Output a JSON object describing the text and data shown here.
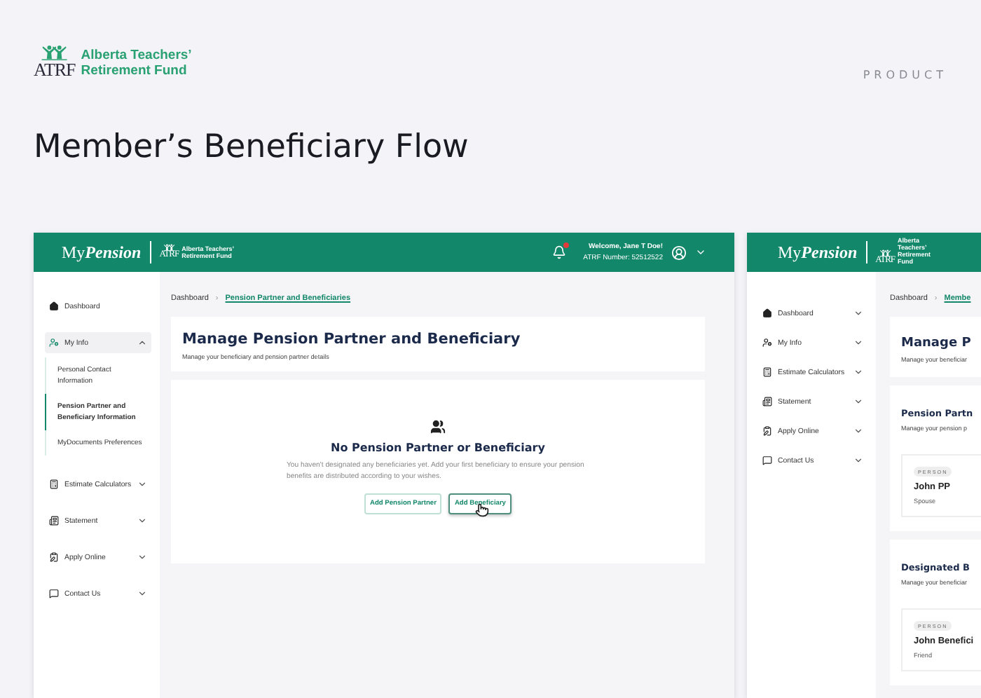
{
  "brand": {
    "mark": "ATRF",
    "line1": "Alberta Teachers’",
    "line2": "Retirement Fund"
  },
  "category": "PRODUCT",
  "title": "Member’s Beneficiary Flow",
  "screens": [
    {
      "kind": "empty",
      "app_name": {
        "prefix": "My",
        "accent": "Pension"
      },
      "org": {
        "mark": "ATRF",
        "line1": "Alberta Teachers’",
        "line2": "Retirement Fund"
      },
      "user": {
        "welcome": "Welcome, Jane T Doe!",
        "number": "ATRF Number: 52512522"
      },
      "sidebar": [
        {
          "label": "Dashboard",
          "selected": false
        },
        {
          "label": "My Info",
          "selected": true,
          "expanded": true,
          "children": [
            {
              "label": "Personal Contact Information",
              "selected": false
            },
            {
              "label": "Pension Partner and Beneficiary Information",
              "selected": true
            },
            {
              "label": "MyDocuments Preferences",
              "selected": false
            }
          ]
        },
        {
          "label": "Estimate Calculators",
          "selected": false,
          "expanded": false
        },
        {
          "label": "Statement",
          "selected": false,
          "expanded": false
        },
        {
          "label": "Apply Online",
          "selected": false,
          "expanded": false
        },
        {
          "label": "Contact Us",
          "selected": false,
          "expanded": false
        }
      ],
      "breadcrumb": {
        "items": [
          "Dashboard",
          "Pension Partner and Beneficiaries"
        ],
        "separator": "›"
      },
      "page_title": "Manage Pension Partner and Beneficiary",
      "page_subtitle": "Manage your beneficiary and pension partner details",
      "empty": {
        "title": "No Pension Partner or Beneficiary",
        "text": "You haven't designated any beneficiaries yet. Add your first beneficiary to ensure your pension benefits are distributed according to your wishes.",
        "buttons": [
          {
            "label": "Add Pension Partner",
            "hovered": false
          },
          {
            "label": "Add Beneficiary",
            "hovered": true
          }
        ]
      }
    },
    {
      "kind": "list",
      "app_name": {
        "prefix": "My",
        "accent": "Pension"
      },
      "org": {
        "mark": "ATRF",
        "line1": "Alberta Teachers’",
        "line2": "Retirement Fund"
      },
      "sidebar": [
        {
          "label": "Dashboard",
          "selected": false,
          "expanded": false
        },
        {
          "label": "My Info",
          "selected": false,
          "expanded": false
        },
        {
          "label": "Estimate Calculators",
          "selected": false,
          "expanded": false
        },
        {
          "label": "Statement",
          "selected": false,
          "expanded": false
        },
        {
          "label": "Apply Online",
          "selected": false,
          "expanded": false
        },
        {
          "label": "Contact Us",
          "selected": false,
          "expanded": false
        }
      ],
      "breadcrumb": {
        "items": [
          "Dashboard",
          "Membe"
        ],
        "separator": "›"
      },
      "page_title": "Manage P",
      "page_subtitle": "Manage your beneficiar",
      "sections": [
        {
          "title": "Pension Partn",
          "subtitle": "Manage your pension p",
          "people": [
            {
              "badge": "PERSON",
              "name": "John PP",
              "relation": "Spouse"
            }
          ]
        },
        {
          "title": "Designated B",
          "subtitle": "Manage your beneficiar",
          "people": [
            {
              "badge": "PERSON",
              "name": "John Benefici",
              "relation": "Friend"
            }
          ]
        }
      ]
    }
  ]
}
